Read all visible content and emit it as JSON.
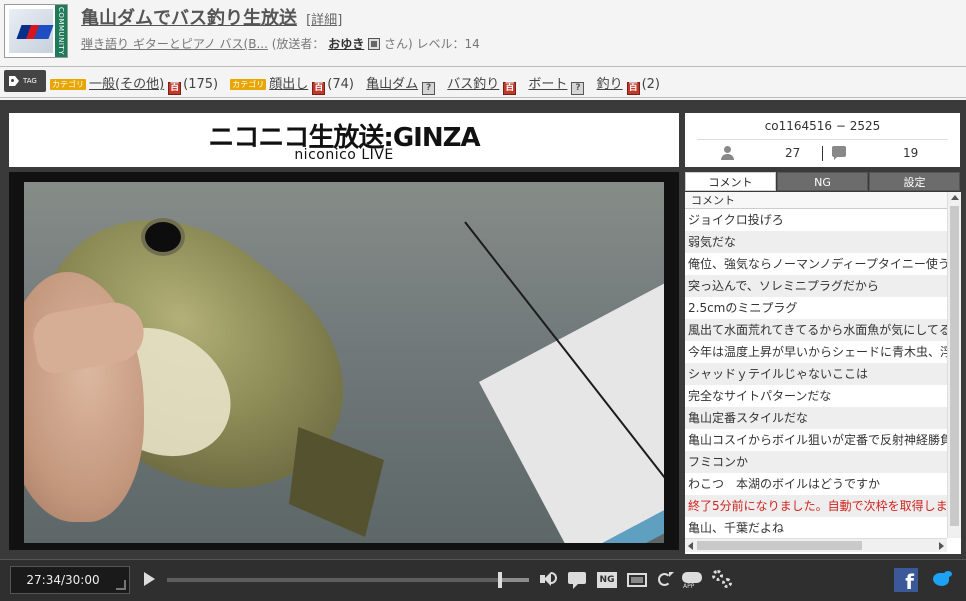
{
  "header": {
    "community_label": "COMMUNITY",
    "title": "亀山ダムでバス釣り生放送",
    "detail_link": "詳細",
    "description": "弾き語り ギターとピアノ バス(B...",
    "broadcaster_prefix": "(放送者：",
    "broadcaster_name": "おゆき",
    "broadcaster_suffix": "さん)",
    "level_text": "レベル：14"
  },
  "tagbar": {
    "badge_text": "TAG",
    "tags": [
      {
        "category": "カテゴリ",
        "label": "一般(その他)",
        "encyclopedia": "red",
        "count": "(175)"
      },
      {
        "category": "カテゴリ",
        "label": "顔出し",
        "encyclopedia": "red",
        "count": "(74)"
      },
      {
        "category": "",
        "label": "亀山ダム",
        "encyclopedia": "gray",
        "count": ""
      },
      {
        "category": "",
        "label": "バス釣り",
        "encyclopedia": "red",
        "count": ""
      },
      {
        "category": "",
        "label": "ボート",
        "encyclopedia": "gray",
        "count": ""
      },
      {
        "category": "",
        "label": "釣り",
        "encyclopedia": "red",
        "count": "(2)"
      }
    ],
    "encyclopedia_glyph": "百",
    "encyclopedia_glyph_gray": "?"
  },
  "banner": {
    "line1": "ニコニコ生放送:GINZA",
    "line2": "niconico LIVE"
  },
  "info": {
    "community_id": "co1164516 − 2525",
    "viewers": "27",
    "comments": "19"
  },
  "tabs": {
    "comment": "コメント",
    "ng": "NG",
    "settings": "設定"
  },
  "comment_list": {
    "header": "コメント",
    "rows": [
      {
        "text": "ジョイクロ投げろ",
        "system": false
      },
      {
        "text": "弱気だな",
        "system": false
      },
      {
        "text": "俺位、強気ならノーマンノディープタイニー使う",
        "system": false
      },
      {
        "text": "突っ込んで、ソレミニプラグだから",
        "system": false
      },
      {
        "text": "2.5cmのミニプラグ",
        "system": false
      },
      {
        "text": "風出て水面荒れてきてるから水面魚が気にしてる",
        "system": false
      },
      {
        "text": "今年は温度上昇が早いからシェードに青木虫、浮",
        "system": false
      },
      {
        "text": "シャッドｙテイルじゃないここは",
        "system": false
      },
      {
        "text": "完全なサイトパターンだな",
        "system": false
      },
      {
        "text": "亀山定番スタイルだな",
        "system": false
      },
      {
        "text": "亀山コスイからボイル狙いが定番で反射神経勝負",
        "system": false
      },
      {
        "text": "フミコンか",
        "system": false
      },
      {
        "text": "わこつ　本湖のボイルはどうですか",
        "system": false
      },
      {
        "text": "終了5分前になりました。自動で次枠を取得しま",
        "system": true
      },
      {
        "text": "亀山、千葉だよね",
        "system": false
      }
    ]
  },
  "controls": {
    "time": "27:34/30:00",
    "ng_label": "NG",
    "progress_fraction": 0.919,
    "fb_glyph": "f"
  },
  "colors": {
    "system_comment": "#d2231f",
    "facebook": "#3b5998",
    "twitter": "#1da1f2",
    "category_badge": "#e8a600"
  }
}
